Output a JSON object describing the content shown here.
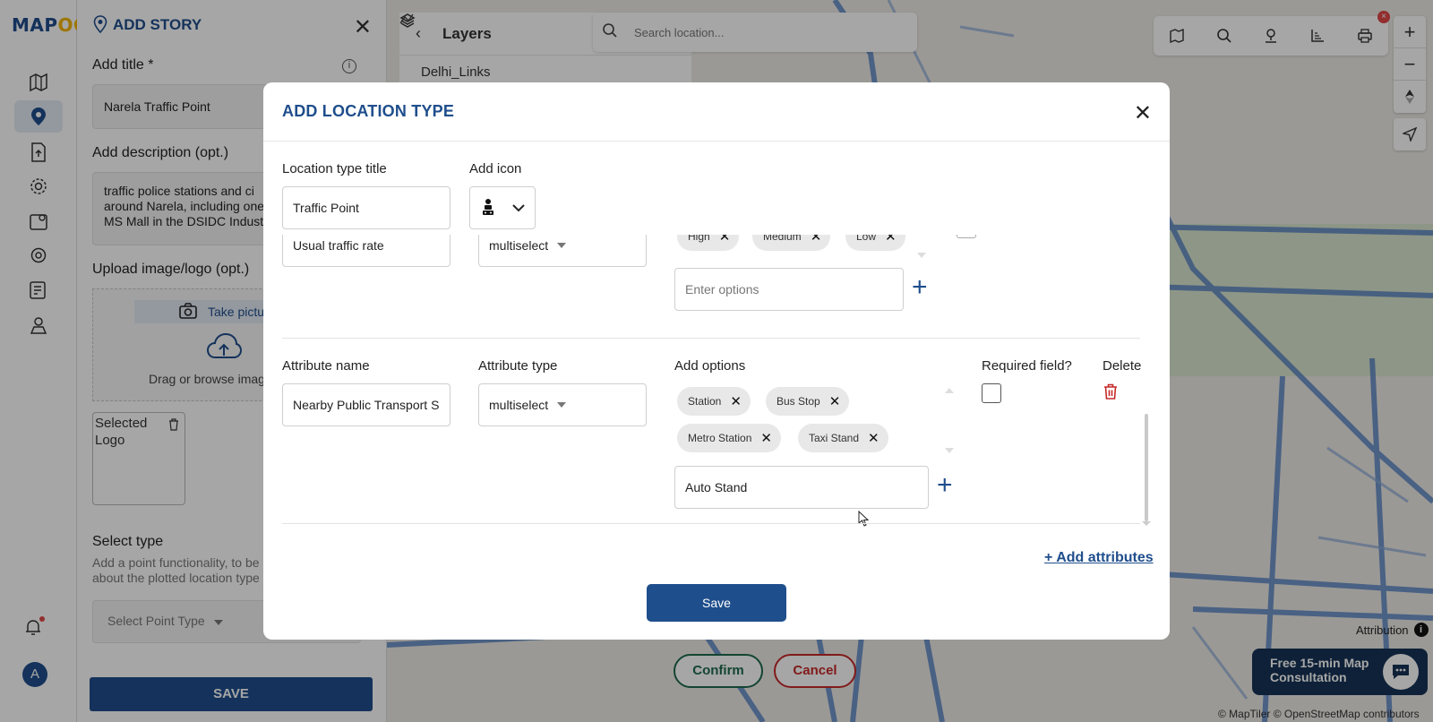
{
  "app": {
    "logo": "MAPOG",
    "logo_main": "MAP",
    "logo_accent": "OG"
  },
  "story_panel": {
    "title": "ADD STORY",
    "title_label": "Add title *",
    "title_value": "Narela Traffic Point",
    "description_label": "Add description (opt.)",
    "description_lines": [
      "traffic police stations and ci",
      "around Narela, including one",
      "MS Mall in the DSIDC Indust"
    ],
    "upload_label": "Upload image/logo (opt.)",
    "take_picture": "Take pictu",
    "drag_text": "Drag or browse imag",
    "thumb_alt": "Selected Logo",
    "select_type_label": "Select type",
    "select_type_help": [
      "Add a point functionality, to be",
      "about the plotted location type"
    ],
    "select_type_placeholder": "Select Point Type",
    "save_label": "SAVE"
  },
  "rail": {
    "avatar_letter": "A"
  },
  "layers": {
    "title": "Layers",
    "row": "Delhi_Links"
  },
  "map": {
    "search_placeholder": "Search location...",
    "attribution": "Attribution",
    "copyright": "© MapTiler © OpenStreetMap contributors",
    "consult_line1": "Free 15-min Map",
    "consult_line2": "Consultation",
    "confirm": "Confirm",
    "cancel": "Cancel"
  },
  "modal": {
    "title": "ADD LOCATION TYPE",
    "type_title_label": "Location type title",
    "type_title_value": "Traffic Point",
    "add_icon_label": "Add icon",
    "row1": {
      "name_value": "Usual traffic rate",
      "type_value": "multiselect",
      "chips": [
        "High",
        "Medium",
        "Low"
      ],
      "options_placeholder": "Enter options"
    },
    "headers": {
      "attr_name": "Attribute name",
      "attr_type": "Attribute type",
      "add_options": "Add options",
      "required": "Required field?",
      "delete": "Delete"
    },
    "row2": {
      "name_value": "Nearby Public Transport S",
      "type_value": "multiselect",
      "chips": [
        "Station",
        "Bus Stop",
        "Metro Station",
        "Taxi Stand"
      ],
      "option_input_value": "Auto Stand"
    },
    "add_attributes": "+ Add attributes",
    "save": "Save"
  },
  "colors": {
    "brand": "#1f4e8c",
    "accent": "#f1b400",
    "danger": "#c62828"
  }
}
